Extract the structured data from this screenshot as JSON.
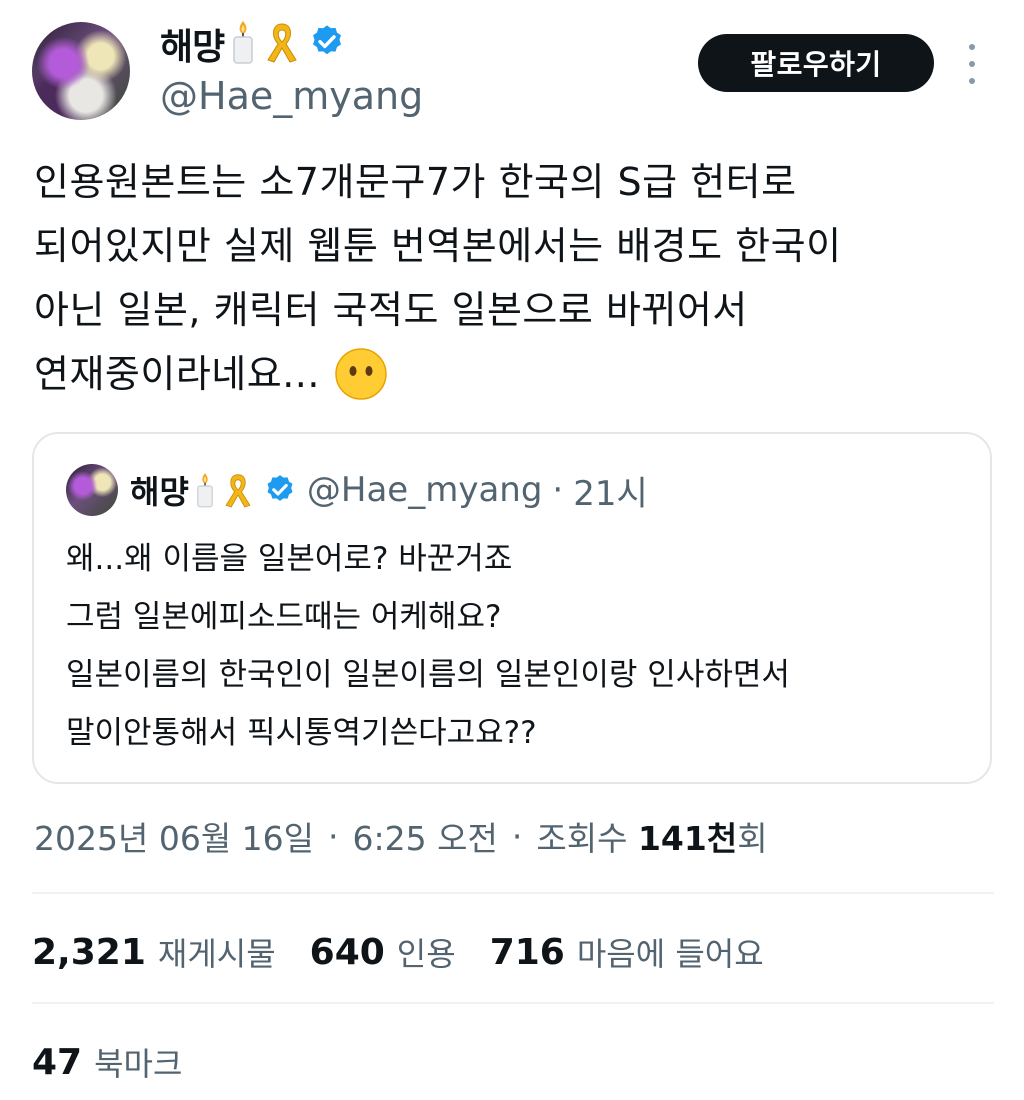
{
  "author": {
    "display_name": "해먕",
    "handle": "@Hae_myang",
    "badges": [
      "candle-emoji",
      "ribbon-emoji",
      "verified-badge"
    ]
  },
  "follow_button": {
    "label": "팔로우하기"
  },
  "tweet": {
    "lines": [
      "인용원본트는 소7개문구7가 한국의 S급 헌터로",
      "되어있지만 실제 웹툰 번역본에서는 배경도 한국이",
      "아닌 일본, 캐릭터 국적도 일본으로 바뀌어서",
      "연재중이라네요..."
    ],
    "trailing_emoji": "no-mouth-face-emoji"
  },
  "quoted": {
    "display_name": "해먕",
    "handle": "@Hae_myang",
    "separator": "·",
    "time": "21시",
    "lines": [
      "왜...왜 이름을 일본어로? 바꾼거죠",
      "그럼 일본에피소드때는 어케해요?",
      "일본이름의 한국인이 일본이름의 일본인이랑 인사하면서",
      "말이안통해서 픽시통역기쓴다고요??"
    ]
  },
  "meta": {
    "date": "2025년 06월 16일",
    "sep1": "·",
    "time": "6:25 오전",
    "sep2": "·",
    "views_label": "조회수",
    "views_count": "141천",
    "views_suffix": "회"
  },
  "stats": {
    "reposts": {
      "count": "2,321",
      "label": "재게시물"
    },
    "quotes": {
      "count": "640",
      "label": "인용"
    },
    "likes": {
      "count": "716",
      "label": "마음에 들어요"
    },
    "bookmarks": {
      "count": "47",
      "label": "북마크"
    }
  },
  "colors": {
    "text": "#0f1419",
    "secondary": "#536471",
    "verified": "#1d9bf0",
    "follow_bg": "#0f1419",
    "border": "#e3e7ea"
  }
}
